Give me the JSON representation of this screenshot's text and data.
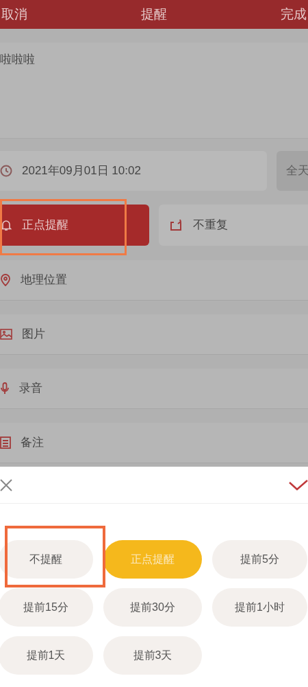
{
  "header": {
    "cancel": "取消",
    "title": "提醒",
    "done": "完成"
  },
  "note": {
    "value": "啦啦啦"
  },
  "date": {
    "text": "2021年09月01日 10:02",
    "all_day": "全天"
  },
  "reminder": {
    "label": "正点提醒",
    "highlighted": true
  },
  "repeat": {
    "label": "不重复"
  },
  "rows": [
    {
      "kind": "location",
      "label": "地理位置"
    },
    {
      "kind": "picture",
      "label": "图片"
    },
    {
      "kind": "audio",
      "label": "录音"
    },
    {
      "kind": "notes",
      "label": "备注"
    }
  ],
  "options": [
    {
      "label": "不提醒",
      "selected": false,
      "highlighted": true
    },
    {
      "label": "正点提醒",
      "selected": true,
      "highlighted": false
    },
    {
      "label": "提前5分",
      "selected": false,
      "highlighted": false
    },
    {
      "label": "提前15分",
      "selected": false,
      "highlighted": false
    },
    {
      "label": "提前30分",
      "selected": false,
      "highlighted": false
    },
    {
      "label": "提前1小时",
      "selected": false,
      "highlighted": false
    },
    {
      "label": "提前1天",
      "selected": false,
      "highlighted": false
    },
    {
      "label": "提前3天",
      "selected": false,
      "highlighted": false
    }
  ]
}
